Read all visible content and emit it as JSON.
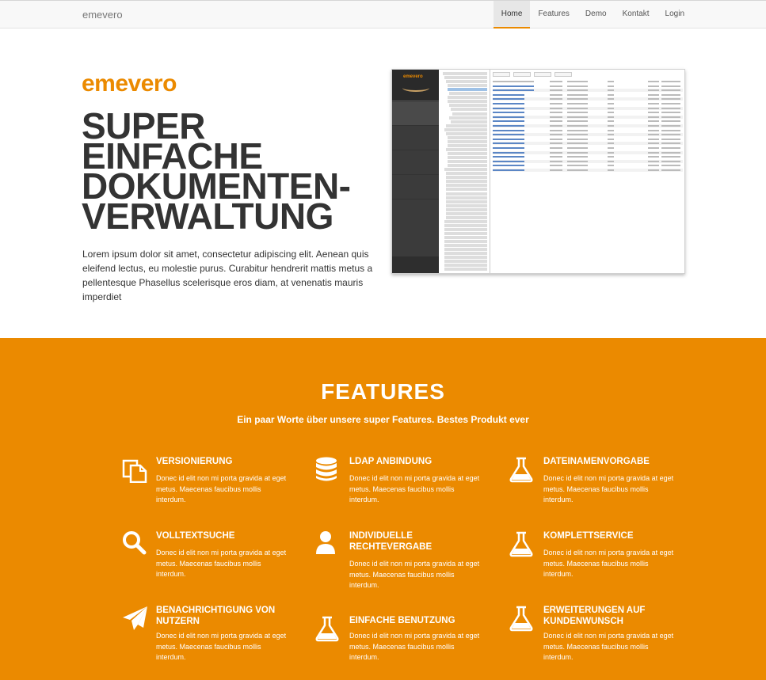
{
  "navbar": {
    "brand": "emevero",
    "items": [
      {
        "label": "Home",
        "active": true
      },
      {
        "label": "Features",
        "active": false
      },
      {
        "label": "Demo",
        "active": false
      },
      {
        "label": "Kontakt",
        "active": false
      },
      {
        "label": "Login",
        "active": false
      }
    ]
  },
  "hero": {
    "brand": "emevero",
    "title_lines": [
      "SUPER",
      "EINFACHE",
      "DOKUMENTEN-",
      "VERWALTUNG"
    ],
    "text": "Lorem ipsum dolor sit amet, consectetur adipiscing elit. Aenean quis eleifend lectus, eu molestie purus. Curabitur hendrerit mattis metus a pellentesque Phasellus scelerisque eros diam, at venenatis mauris imperdiet"
  },
  "app_screenshot": {
    "logo": "emevero"
  },
  "features": {
    "title": "FEATURES",
    "subtitle": "Ein paar Worte über unsere super Features. Bestes Produkt ever",
    "items": [
      {
        "title": "VERSIONIERUNG",
        "text": "Donec id elit non mi porta gravida at eget metus. Maecenas faucibus mollis interdum.",
        "icon": "copy-icon"
      },
      {
        "title": "LDAP ANBINDUNG",
        "text": "Donec id elit non mi porta gravida at eget metus. Maecenas faucibus mollis interdum.",
        "icon": "database-icon"
      },
      {
        "title": "DATEINAMENVORGABE",
        "text": "Donec id elit non mi porta gravida at eget metus. Maecenas faucibus mollis interdum.",
        "icon": "flask-icon"
      },
      {
        "title": "VOLLTEXTSUCHE",
        "text": "Donec id elit non mi porta gravida at eget metus. Maecenas faucibus mollis interdum.",
        "icon": "search-icon"
      },
      {
        "title": "INDIVIDUELLE RECHTEVERGABE",
        "text": "Donec id elit non mi porta gravida at eget metus. Maecenas faucibus mollis interdum.",
        "icon": "user-icon"
      },
      {
        "title": "KOMPLETTSERVICE",
        "text": "Donec id elit non mi porta gravida at eget metus. Maecenas faucibus mollis interdum.",
        "icon": "flask-icon"
      },
      {
        "title": "BENACHRICHTIGUNG VON NUTZERN",
        "text": "Donec id elit non mi porta gravida at eget metus. Maecenas faucibus mollis interdum.",
        "icon": "paper-plane-icon"
      },
      {
        "title": "EINFACHE BENUTZUNG",
        "text": "Donec id elit non mi porta gravida at eget metus. Maecenas faucibus mollis interdum.",
        "icon": "flask-icon"
      },
      {
        "title": "ERWEITERUNGEN AUF KUNDENWUNSCH",
        "text": "Donec id elit non mi porta gravida at eget metus. Maecenas faucibus mollis interdum.",
        "icon": "flask-icon"
      }
    ]
  },
  "colors": {
    "accent": "#eb8a00",
    "text_dark": "#333333",
    "navbar_bg": "#f8f8f8"
  }
}
